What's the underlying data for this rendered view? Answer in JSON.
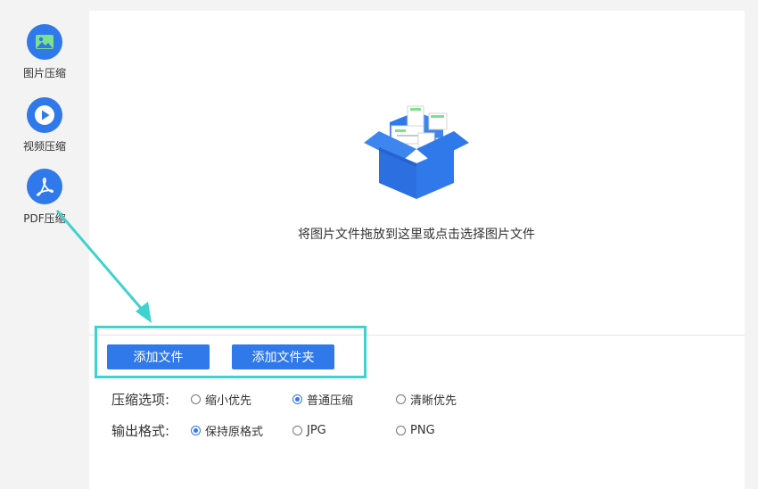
{
  "sidebar": {
    "items": [
      {
        "label": "图片压缩",
        "icon": "image-icon"
      },
      {
        "label": "视频压缩",
        "icon": "play-icon"
      },
      {
        "label": "PDF压缩",
        "icon": "pdf-icon"
      }
    ]
  },
  "dropzone": {
    "text": "将图片文件拖放到这里或点击选择图片文件",
    "icon": "open-box-icon"
  },
  "buttons": {
    "add_file": "添加文件",
    "add_folder": "添加文件夹"
  },
  "compression": {
    "label": "压缩选项:",
    "options": [
      "缩小优先",
      "普通压缩",
      "清晰优先"
    ],
    "selected": "普通压缩"
  },
  "output": {
    "label": "输出格式:",
    "options": [
      "保持原格式",
      "JPG",
      "PNG"
    ],
    "selected": "保持原格式"
  },
  "colors": {
    "accent": "#2f79ea",
    "highlight": "#3fd2cf"
  }
}
